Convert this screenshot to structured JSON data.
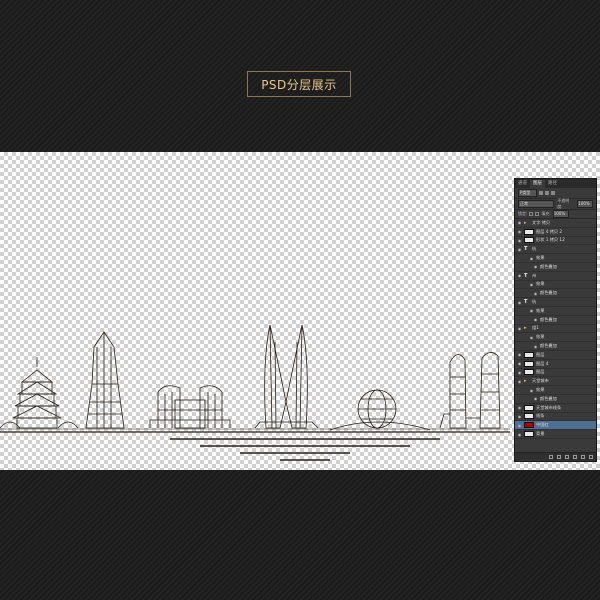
{
  "header": {
    "title": "PSD分层展示"
  },
  "panel": {
    "tabs": [
      "通道",
      "图层",
      "路径"
    ],
    "kind_select": "P类型",
    "blend_mode": "正常",
    "opacity_label": "不透明度:",
    "opacity_value": "100%",
    "lock_label": "锁定:",
    "fill_label": "填充:",
    "fill_value": "100%",
    "layers": [
      {
        "type": "folder",
        "label": "文字 拷贝",
        "level": 0
      },
      {
        "type": "image",
        "label": "图层 4 拷贝 2",
        "level": 1
      },
      {
        "type": "image",
        "label": "形状 1 拷贝 12",
        "level": 1
      },
      {
        "type": "text",
        "label": "杭",
        "level": 1
      },
      {
        "type": "fx",
        "label": "效果",
        "level": 2
      },
      {
        "type": "fx",
        "label": "颜色叠加",
        "level": 3
      },
      {
        "type": "text",
        "label": "州",
        "level": 1
      },
      {
        "type": "fx",
        "label": "效果",
        "level": 2
      },
      {
        "type": "fx",
        "label": "颜色叠加",
        "level": 3
      },
      {
        "type": "text",
        "label": "杭",
        "level": 1
      },
      {
        "type": "fx",
        "label": "效果",
        "level": 2
      },
      {
        "type": "fx",
        "label": "颜色叠加",
        "level": 3
      },
      {
        "type": "folder",
        "label": "组1",
        "level": 0
      },
      {
        "type": "fx",
        "label": "效果",
        "level": 2
      },
      {
        "type": "fx",
        "label": "颜色叠加",
        "level": 3
      },
      {
        "type": "image",
        "label": "图层",
        "level": 1
      },
      {
        "type": "image",
        "label": "图层 4",
        "level": 1
      },
      {
        "type": "image",
        "label": "图层",
        "level": 1
      },
      {
        "type": "folder",
        "label": "天堂城市",
        "level": 0
      },
      {
        "type": "fx",
        "label": "效果",
        "level": 2
      },
      {
        "type": "fx",
        "label": "颜色叠加",
        "level": 3
      },
      {
        "type": "image",
        "label": "天堂城市线条",
        "level": 1
      },
      {
        "type": "image",
        "label": "线条",
        "level": 1
      },
      {
        "type": "red",
        "label": "中国红",
        "level": 0,
        "selected": true
      },
      {
        "type": "image",
        "label": "背景",
        "level": 0
      }
    ]
  },
  "colors": {
    "accent": "#e8c98a",
    "border": "#8a7650",
    "panel_bg": "#3a3a3a",
    "selected": "#4e6e93",
    "red_layer": "#b00000"
  }
}
